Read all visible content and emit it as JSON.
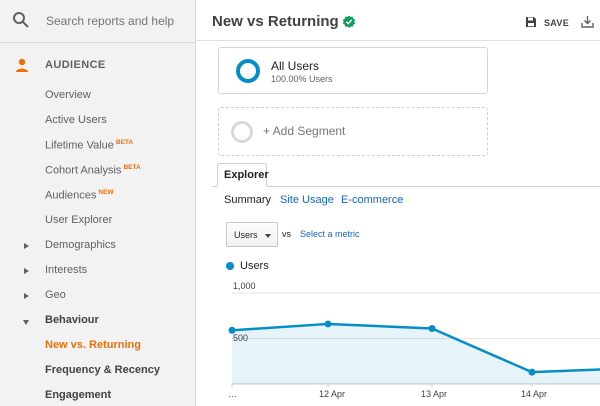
{
  "search": {
    "placeholder": "Search reports and help"
  },
  "sidebar": {
    "section_title": "AUDIENCE",
    "items": [
      {
        "label": "Overview",
        "badge": ""
      },
      {
        "label": "Active Users",
        "badge": ""
      },
      {
        "label": "Lifetime Value",
        "badge": "BETA"
      },
      {
        "label": "Cohort Analysis",
        "badge": "BETA"
      },
      {
        "label": "Audiences",
        "badge": "NEW"
      },
      {
        "label": "User Explorer",
        "badge": ""
      },
      {
        "label": "Demographics",
        "badge": ""
      },
      {
        "label": "Interests",
        "badge": ""
      },
      {
        "label": "Geo",
        "badge": ""
      },
      {
        "label": "Behaviour",
        "badge": ""
      },
      {
        "label": "New vs. Returning",
        "badge": ""
      },
      {
        "label": "Frequency & Recency",
        "badge": ""
      },
      {
        "label": "Engagement",
        "badge": ""
      }
    ]
  },
  "header": {
    "title": "New vs Returning",
    "save_label": "SAVE"
  },
  "segments": {
    "all_users": {
      "name": "All Users",
      "percent": "100.00% Users"
    },
    "add_label": "+ Add Segment"
  },
  "tabs": {
    "explorer": "Explorer"
  },
  "subtabs": [
    "Summary",
    "Site Usage",
    "E-commerce"
  ],
  "metric": {
    "selected": "Users",
    "vs": "vs",
    "select_label": "Select a metric"
  },
  "colors": {
    "accent": "#058dc7",
    "active_nav": "#e8710a",
    "verified": "#0f9d58"
  },
  "chart_data": {
    "type": "area",
    "series": [
      {
        "name": "Users",
        "values": [
          590,
          660,
          610,
          130,
          160
        ]
      }
    ],
    "x_labels": [
      "…",
      "12 Apr",
      "13 Apr",
      "14 Apr",
      ""
    ],
    "y_ticks": [
      "1,000",
      "500"
    ],
    "ylim": [
      0,
      1000
    ],
    "grid": true
  }
}
